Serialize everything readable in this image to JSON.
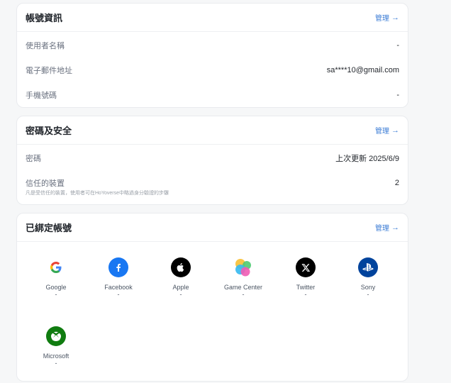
{
  "account_info": {
    "title": "帳號資訊",
    "manage": "管理",
    "rows": [
      {
        "label": "使用者名稱",
        "value": "-"
      },
      {
        "label": "電子郵件地址",
        "value": "sa****10@gmail.com"
      },
      {
        "label": "手機號碼",
        "value": "-"
      }
    ]
  },
  "security": {
    "title": "密碼及安全",
    "manage": "管理",
    "password": {
      "label": "密碼",
      "value": "上次更新 2025/6/9"
    },
    "devices": {
      "label": "信任的裝置",
      "value": "2",
      "hint": "凡是受信任的裝置，使用者可在HoYoverse中略過身分驗證的步驟"
    }
  },
  "linked": {
    "title": "已綁定帳號",
    "manage": "管理",
    "accounts": [
      {
        "name": "Google",
        "status": "-",
        "icon": "google-icon"
      },
      {
        "name": "Facebook",
        "status": "-",
        "icon": "facebook-icon",
        "color": "#1877f2"
      },
      {
        "name": "Apple",
        "status": "-",
        "icon": "apple-icon",
        "color": "#000000"
      },
      {
        "name": "Game Center",
        "status": "-",
        "icon": "game-center-icon"
      },
      {
        "name": "Twitter",
        "status": "-",
        "icon": "x-icon",
        "color": "#000000"
      },
      {
        "name": "Sony",
        "status": "-",
        "icon": "playstation-icon",
        "color": "#00439c"
      },
      {
        "name": "Microsoft",
        "status": "-",
        "icon": "xbox-icon",
        "color": "#107c10"
      }
    ]
  }
}
